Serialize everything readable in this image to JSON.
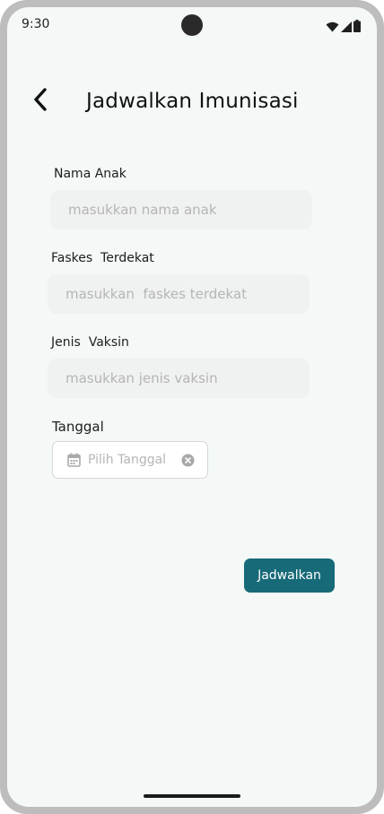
{
  "status_bar": {
    "time": "9:30"
  },
  "header": {
    "title": "Jadwalkan Imunisasi",
    "back_icon": "chevron-left-icon"
  },
  "form": {
    "nama_anak": {
      "label": "Nama Anak",
      "placeholder": "masukkan nama anak",
      "value": ""
    },
    "faskes": {
      "label": "Faskes  Terdekat",
      "placeholder": "masukkan  faskes terdekat",
      "value": ""
    },
    "vaksin": {
      "label": "Jenis  Vaksin",
      "placeholder": "masukkan jenis vaksin",
      "value": ""
    },
    "tanggal": {
      "label": "Tanggal",
      "placeholder": "Pilih Tanggal",
      "value": ""
    }
  },
  "actions": {
    "submit_label": "Jadwalkan"
  },
  "colors": {
    "background": "#f4f9f8",
    "primary": "#176a78",
    "input_bg": "#f0f1f1",
    "placeholder": "#b5b5b5"
  }
}
